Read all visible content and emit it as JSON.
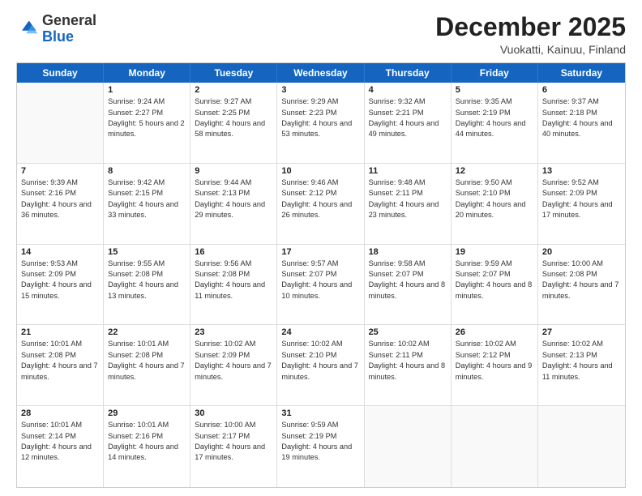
{
  "logo": {
    "general": "General",
    "blue": "Blue"
  },
  "title": "December 2025",
  "location": "Vuokatti, Kainuu, Finland",
  "header_days": [
    "Sunday",
    "Monday",
    "Tuesday",
    "Wednesday",
    "Thursday",
    "Friday",
    "Saturday"
  ],
  "weeks": [
    [
      {
        "day": "",
        "sunrise": "",
        "sunset": "",
        "daylight": ""
      },
      {
        "day": "1",
        "sunrise": "Sunrise: 9:24 AM",
        "sunset": "Sunset: 2:27 PM",
        "daylight": "Daylight: 5 hours and 2 minutes."
      },
      {
        "day": "2",
        "sunrise": "Sunrise: 9:27 AM",
        "sunset": "Sunset: 2:25 PM",
        "daylight": "Daylight: 4 hours and 58 minutes."
      },
      {
        "day": "3",
        "sunrise": "Sunrise: 9:29 AM",
        "sunset": "Sunset: 2:23 PM",
        "daylight": "Daylight: 4 hours and 53 minutes."
      },
      {
        "day": "4",
        "sunrise": "Sunrise: 9:32 AM",
        "sunset": "Sunset: 2:21 PM",
        "daylight": "Daylight: 4 hours and 49 minutes."
      },
      {
        "day": "5",
        "sunrise": "Sunrise: 9:35 AM",
        "sunset": "Sunset: 2:19 PM",
        "daylight": "Daylight: 4 hours and 44 minutes."
      },
      {
        "day": "6",
        "sunrise": "Sunrise: 9:37 AM",
        "sunset": "Sunset: 2:18 PM",
        "daylight": "Daylight: 4 hours and 40 minutes."
      }
    ],
    [
      {
        "day": "7",
        "sunrise": "Sunrise: 9:39 AM",
        "sunset": "Sunset: 2:16 PM",
        "daylight": "Daylight: 4 hours and 36 minutes."
      },
      {
        "day": "8",
        "sunrise": "Sunrise: 9:42 AM",
        "sunset": "Sunset: 2:15 PM",
        "daylight": "Daylight: 4 hours and 33 minutes."
      },
      {
        "day": "9",
        "sunrise": "Sunrise: 9:44 AM",
        "sunset": "Sunset: 2:13 PM",
        "daylight": "Daylight: 4 hours and 29 minutes."
      },
      {
        "day": "10",
        "sunrise": "Sunrise: 9:46 AM",
        "sunset": "Sunset: 2:12 PM",
        "daylight": "Daylight: 4 hours and 26 minutes."
      },
      {
        "day": "11",
        "sunrise": "Sunrise: 9:48 AM",
        "sunset": "Sunset: 2:11 PM",
        "daylight": "Daylight: 4 hours and 23 minutes."
      },
      {
        "day": "12",
        "sunrise": "Sunrise: 9:50 AM",
        "sunset": "Sunset: 2:10 PM",
        "daylight": "Daylight: 4 hours and 20 minutes."
      },
      {
        "day": "13",
        "sunrise": "Sunrise: 9:52 AM",
        "sunset": "Sunset: 2:09 PM",
        "daylight": "Daylight: 4 hours and 17 minutes."
      }
    ],
    [
      {
        "day": "14",
        "sunrise": "Sunrise: 9:53 AM",
        "sunset": "Sunset: 2:09 PM",
        "daylight": "Daylight: 4 hours and 15 minutes."
      },
      {
        "day": "15",
        "sunrise": "Sunrise: 9:55 AM",
        "sunset": "Sunset: 2:08 PM",
        "daylight": "Daylight: 4 hours and 13 minutes."
      },
      {
        "day": "16",
        "sunrise": "Sunrise: 9:56 AM",
        "sunset": "Sunset: 2:08 PM",
        "daylight": "Daylight: 4 hours and 11 minutes."
      },
      {
        "day": "17",
        "sunrise": "Sunrise: 9:57 AM",
        "sunset": "Sunset: 2:07 PM",
        "daylight": "Daylight: 4 hours and 10 minutes."
      },
      {
        "day": "18",
        "sunrise": "Sunrise: 9:58 AM",
        "sunset": "Sunset: 2:07 PM",
        "daylight": "Daylight: 4 hours and 8 minutes."
      },
      {
        "day": "19",
        "sunrise": "Sunrise: 9:59 AM",
        "sunset": "Sunset: 2:07 PM",
        "daylight": "Daylight: 4 hours and 8 minutes."
      },
      {
        "day": "20",
        "sunrise": "Sunrise: 10:00 AM",
        "sunset": "Sunset: 2:08 PM",
        "daylight": "Daylight: 4 hours and 7 minutes."
      }
    ],
    [
      {
        "day": "21",
        "sunrise": "Sunrise: 10:01 AM",
        "sunset": "Sunset: 2:08 PM",
        "daylight": "Daylight: 4 hours and 7 minutes."
      },
      {
        "day": "22",
        "sunrise": "Sunrise: 10:01 AM",
        "sunset": "Sunset: 2:08 PM",
        "daylight": "Daylight: 4 hours and 7 minutes."
      },
      {
        "day": "23",
        "sunrise": "Sunrise: 10:02 AM",
        "sunset": "Sunset: 2:09 PM",
        "daylight": "Daylight: 4 hours and 7 minutes."
      },
      {
        "day": "24",
        "sunrise": "Sunrise: 10:02 AM",
        "sunset": "Sunset: 2:10 PM",
        "daylight": "Daylight: 4 hours and 7 minutes."
      },
      {
        "day": "25",
        "sunrise": "Sunrise: 10:02 AM",
        "sunset": "Sunset: 2:11 PM",
        "daylight": "Daylight: 4 hours and 8 minutes."
      },
      {
        "day": "26",
        "sunrise": "Sunrise: 10:02 AM",
        "sunset": "Sunset: 2:12 PM",
        "daylight": "Daylight: 4 hours and 9 minutes."
      },
      {
        "day": "27",
        "sunrise": "Sunrise: 10:02 AM",
        "sunset": "Sunset: 2:13 PM",
        "daylight": "Daylight: 4 hours and 11 minutes."
      }
    ],
    [
      {
        "day": "28",
        "sunrise": "Sunrise: 10:01 AM",
        "sunset": "Sunset: 2:14 PM",
        "daylight": "Daylight: 4 hours and 12 minutes."
      },
      {
        "day": "29",
        "sunrise": "Sunrise: 10:01 AM",
        "sunset": "Sunset: 2:16 PM",
        "daylight": "Daylight: 4 hours and 14 minutes."
      },
      {
        "day": "30",
        "sunrise": "Sunrise: 10:00 AM",
        "sunset": "Sunset: 2:17 PM",
        "daylight": "Daylight: 4 hours and 17 minutes."
      },
      {
        "day": "31",
        "sunrise": "Sunrise: 9:59 AM",
        "sunset": "Sunset: 2:19 PM",
        "daylight": "Daylight: 4 hours and 19 minutes."
      },
      {
        "day": "",
        "sunrise": "",
        "sunset": "",
        "daylight": ""
      },
      {
        "day": "",
        "sunrise": "",
        "sunset": "",
        "daylight": ""
      },
      {
        "day": "",
        "sunrise": "",
        "sunset": "",
        "daylight": ""
      }
    ]
  ]
}
